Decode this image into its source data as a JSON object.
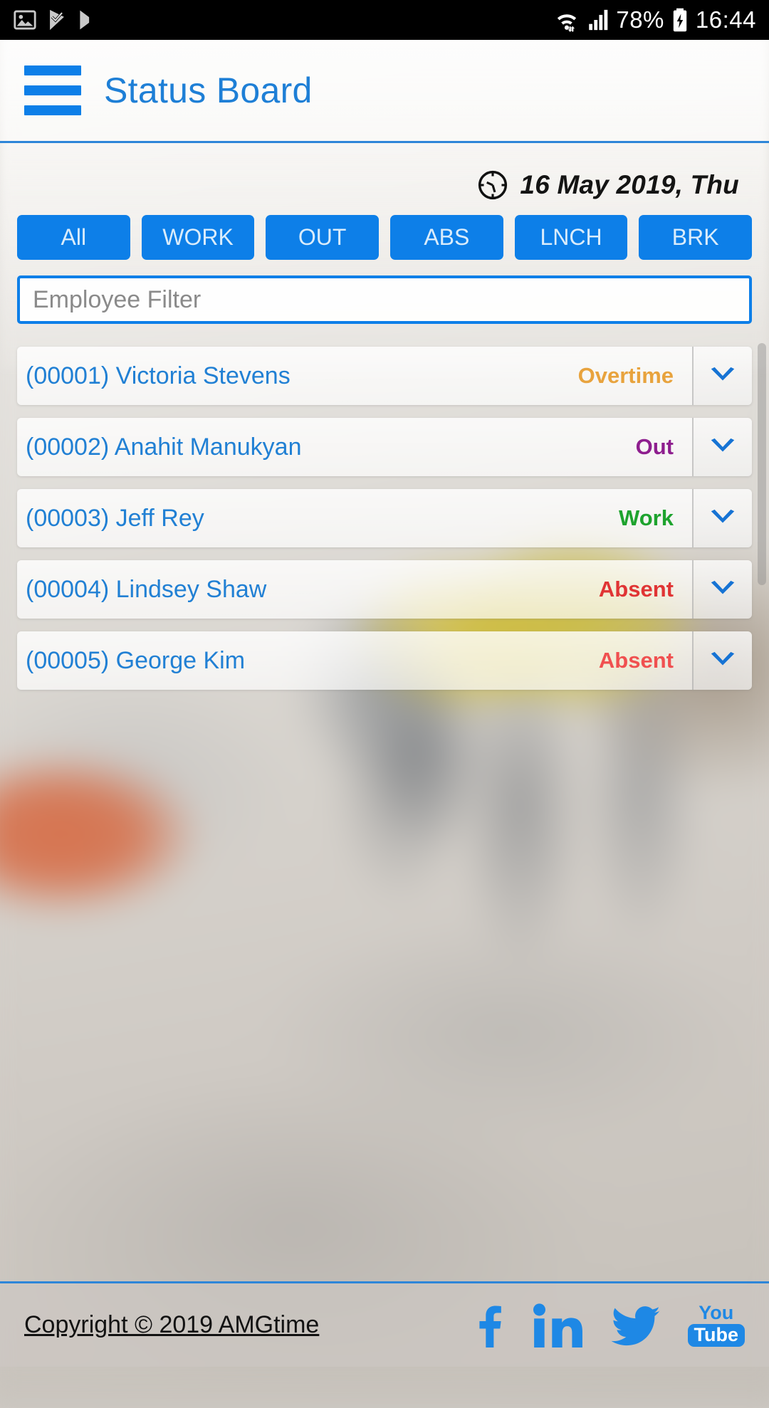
{
  "status_bar": {
    "icons": [
      "image-icon",
      "app-update-icon",
      "google-play-icon"
    ],
    "battery_percent": "78%",
    "time": "16:44",
    "wifi_icon": "wifi-icon",
    "signal_icon": "signal-icon",
    "battery_icon": "battery-charging-icon"
  },
  "app_bar": {
    "menu_icon": "hamburger-menu-icon",
    "title": "Status Board"
  },
  "date_bar": {
    "clock_icon": "clock-icon",
    "date": "16 May 2019, Thu"
  },
  "filters": {
    "buttons": [
      {
        "label": "All"
      },
      {
        "label": "WORK"
      },
      {
        "label": "OUT"
      },
      {
        "label": "ABS"
      },
      {
        "label": "LNCH"
      },
      {
        "label": "BRK"
      }
    ]
  },
  "employee_filter": {
    "placeholder": "Employee Filter",
    "value": ""
  },
  "employee_list": {
    "rows": [
      {
        "name": "(00001) Victoria Stevens",
        "status": "Overtime",
        "status_color": "#e8a33d",
        "expand_icon": "chevron-down-icon"
      },
      {
        "name": "(00002) Anahit Manukyan",
        "status": "Out",
        "status_color": "#8e1e8e",
        "expand_icon": "chevron-down-icon"
      },
      {
        "name": "(00003) Jeff Rey",
        "status": "Work",
        "status_color": "#1ea32e",
        "expand_icon": "chevron-down-icon"
      },
      {
        "name": "(00004) Lindsey Shaw",
        "status": "Absent",
        "status_color": "#e03434",
        "expand_icon": "chevron-down-icon"
      },
      {
        "name": "(00005) George Kim",
        "status": "Absent",
        "status_color": "#f05050",
        "expand_icon": "chevron-down-icon"
      }
    ]
  },
  "footer": {
    "copyright": "Copyright © 2019 AMGtime",
    "socials": [
      {
        "name": "facebook-icon",
        "label": "f"
      },
      {
        "name": "linkedin-icon",
        "label": "in"
      },
      {
        "name": "twitter-icon",
        "label": "t"
      },
      {
        "name": "youtube-icon",
        "label_top": "You",
        "label_bottom": "Tube"
      }
    ]
  },
  "colors": {
    "accent_blue": "#0d7fe8",
    "title_blue": "#1e7fd6",
    "name_blue": "#2180d4",
    "divider_blue": "#2e86d8"
  }
}
